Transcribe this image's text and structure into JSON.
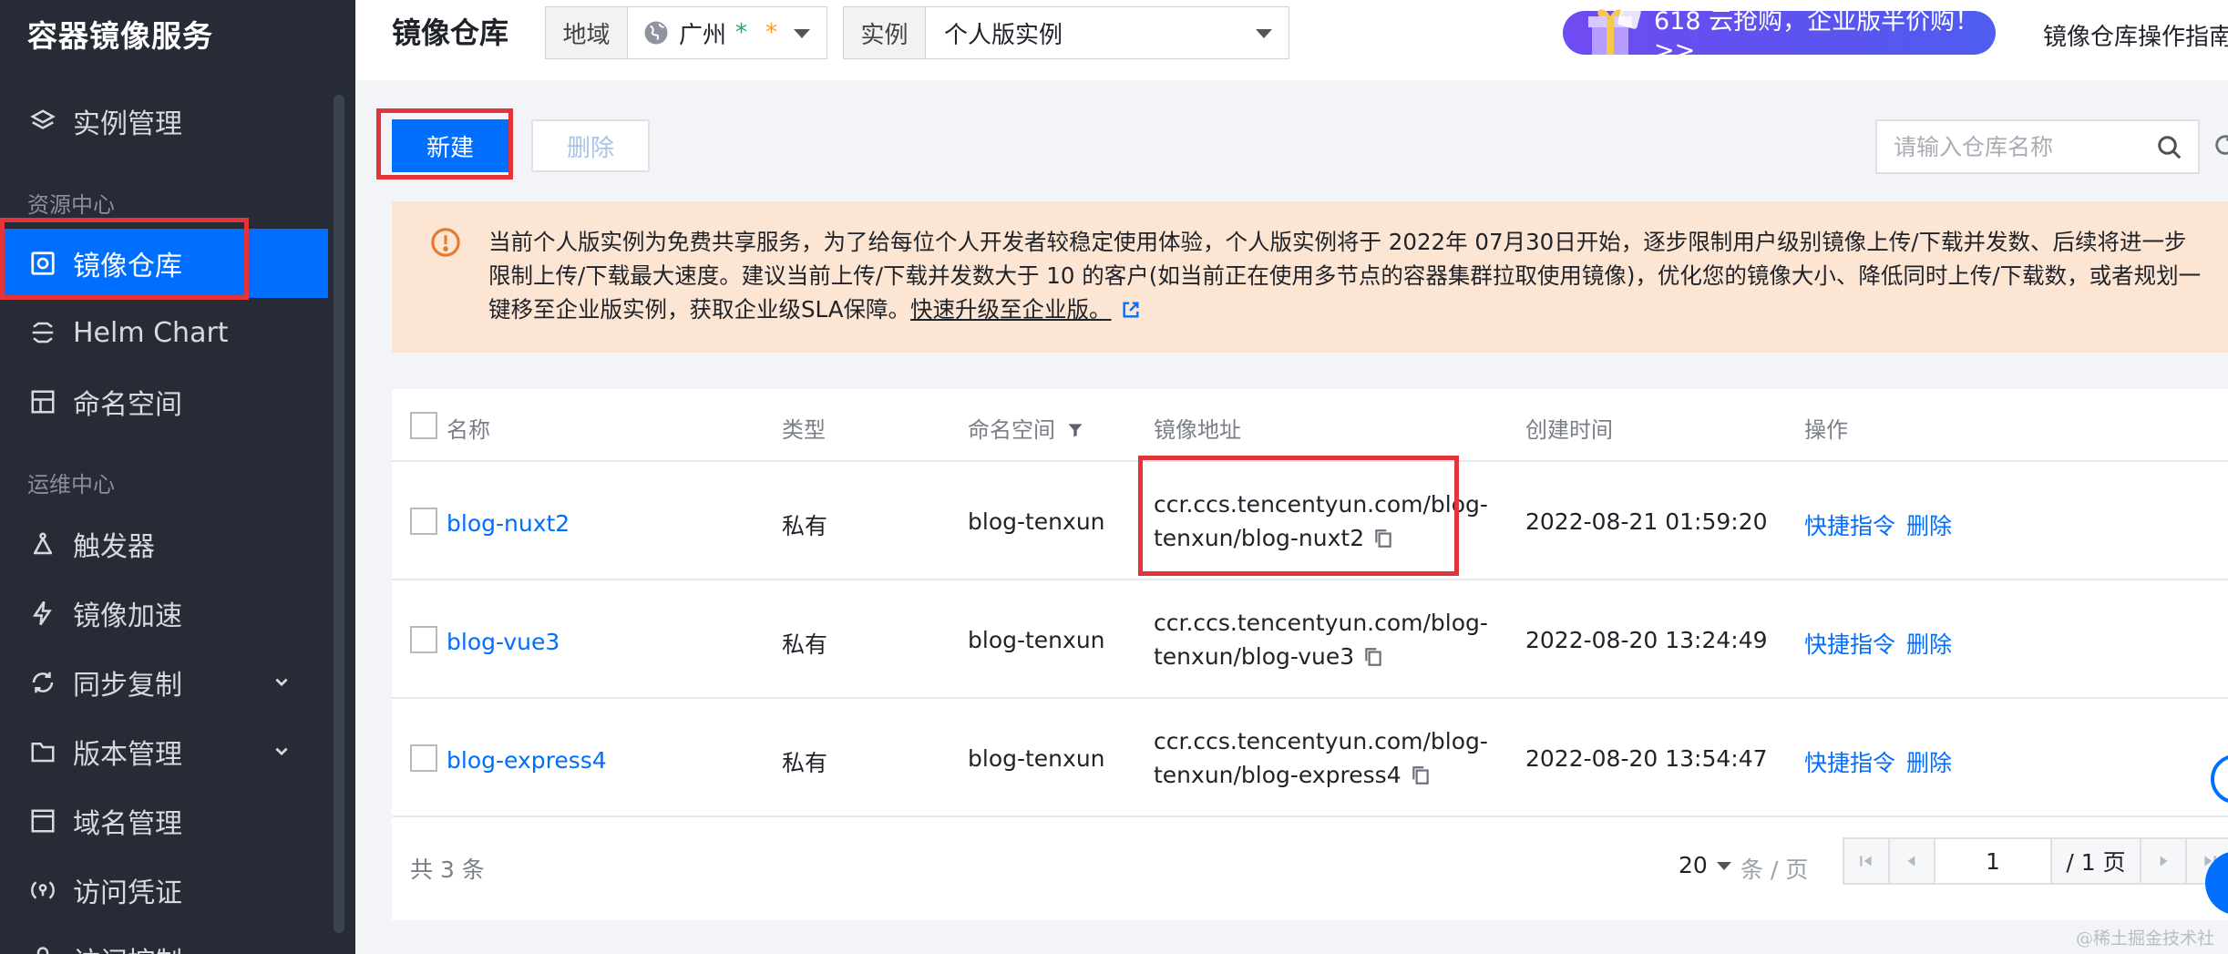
{
  "sidebar": {
    "brand": "容器镜像服务",
    "items": [
      {
        "label": "实例管理",
        "icon": "layers-icon"
      },
      {
        "label": "镜像仓库",
        "icon": "repository-icon",
        "active": true
      },
      {
        "label": "Helm Chart",
        "icon": "helm-chart-icon"
      },
      {
        "label": "命名空间",
        "icon": "namespace-grid-icon"
      },
      {
        "label": "触发器",
        "icon": "trigger-icon"
      },
      {
        "label": "镜像加速",
        "icon": "lightning-icon"
      },
      {
        "label": "同步复制",
        "icon": "sync-icon",
        "expandable": true
      },
      {
        "label": "版本管理",
        "icon": "folder-icon",
        "expandable": true
      },
      {
        "label": "域名管理",
        "icon": "domain-icon"
      },
      {
        "label": "访问凭证",
        "icon": "credential-icon"
      },
      {
        "label": "访问控制",
        "icon": "access-control-icon"
      }
    ],
    "groups": {
      "resource_center": "资源中心",
      "ops_center": "运维中心"
    }
  },
  "header": {
    "title": "镜像仓库",
    "region_label": "地域",
    "region_value": "广州",
    "region_star_green": "*",
    "region_star_orange": "*",
    "instance_label": "实例",
    "instance_value": "个人版实例",
    "promo_text": "618 云抢购，企业版半价购！ >>",
    "guide_link": "镜像仓库操作指南"
  },
  "toolbar": {
    "new_label": "新建",
    "delete_label": "删除",
    "search_placeholder": "请输入仓库名称"
  },
  "notice": {
    "text": "当前个人版实例为免费共享服务，为了给每位个人开发者较稳定使用体验，个人版实例将于 2022年 07月30日开始，逐步限制用户级别镜像上传/下载并发数、后续将进一步限制上传/下载最大速度。建议当前上传/下载并发数大于 10 的客户(如当前正在使用多节点的容器集群拉取使用镜像)，优化您的镜像大小、降低同时上传/下载数，或者规划一键移至企业版实例，获取企业级SLA保障。",
    "link": "快速升级至企业版。"
  },
  "table": {
    "headers": {
      "name": "名称",
      "type": "类型",
      "namespace": "命名空间",
      "address": "镜像地址",
      "created": "创建时间",
      "actions": "操作"
    },
    "rows": [
      {
        "name": "blog-nuxt2",
        "type": "私有",
        "namespace": "blog-tenxun",
        "address_line1": "ccr.ccs.tencentyun.com/blog-",
        "address_line2": "tenxun/blog-nuxt2",
        "created": "2022-08-21 01:59:20",
        "action_cmd": "快捷指令",
        "action_delete": "删除"
      },
      {
        "name": "blog-vue3",
        "type": "私有",
        "namespace": "blog-tenxun",
        "address_line1": "ccr.ccs.tencentyun.com/blog-",
        "address_line2": "tenxun/blog-vue3",
        "created": "2022-08-20 13:24:49",
        "action_cmd": "快捷指令",
        "action_delete": "删除"
      },
      {
        "name": "blog-express4",
        "type": "私有",
        "namespace": "blog-tenxun",
        "address_line1": "ccr.ccs.tencentyun.com/blog-",
        "address_line2": "tenxun/blog-express4",
        "created": "2022-08-20 13:54:47",
        "action_cmd": "快捷指令",
        "action_delete": "删除"
      }
    ],
    "footer": {
      "total": "共 3 条",
      "page_size": "20",
      "page_size_unit": "条 / 页",
      "current_page": "1",
      "total_pages": "/ 1 页"
    }
  },
  "watermark": "@稀土掘金技术社区",
  "colors": {
    "accent": "#006eff",
    "sidebar_bg": "#262b36",
    "highlight_box": "#e3343b",
    "notice_bg": "#fde5d4"
  }
}
